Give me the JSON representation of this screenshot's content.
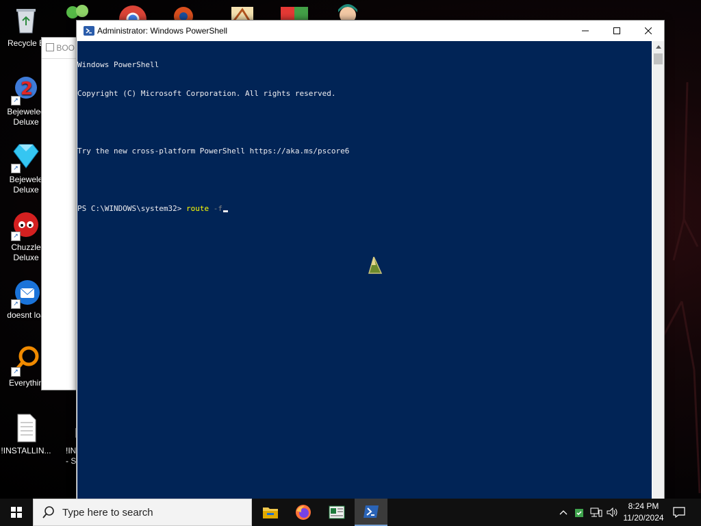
{
  "desktop": {
    "icons": [
      {
        "label": "Recycle B",
        "icon": "recycle-bin-icon"
      },
      {
        "label": "Bejeweled\nDeluxe",
        "icon": "bejeweled-2-icon"
      },
      {
        "label": "Bejewele\nDeluxe",
        "icon": "bejeweled-gem-icon"
      },
      {
        "label": "Chuzzle\nDeluxe",
        "icon": "chuzzle-icon"
      },
      {
        "label": "doesnt loa",
        "icon": "thunderbird-icon"
      },
      {
        "label": "Everythin",
        "icon": "everything-search-icon"
      },
      {
        "label": "!INSTALLIN...",
        "icon": "text-file-icon"
      },
      {
        "label": "!INST\n- Sh",
        "icon": "text-file-icon"
      }
    ]
  },
  "background_window": {
    "title": "BOO"
  },
  "powershell": {
    "window_title": "Administrator: Windows PowerShell",
    "lines": [
      "Windows PowerShell",
      "Copyright (C) Microsoft Corporation. All rights reserved.",
      "",
      "Try the new cross-platform PowerShell https://aka.ms/pscore6",
      ""
    ],
    "prompt": "PS C:\\WINDOWS\\system32> ",
    "command": "route",
    "parameter": " -f",
    "colors": {
      "background": "#012456",
      "text": "#eeedf0",
      "command": "#ffff00",
      "parameter": "#808080"
    }
  },
  "taskbar": {
    "search_placeholder": "Type here to search",
    "apps": [
      "file-explorer-icon",
      "firefox-icon",
      "news-app-icon",
      "powershell-icon"
    ],
    "active_app": "powershell-icon",
    "clock_time": "8:24 PM",
    "clock_date": "11/20/2024"
  }
}
